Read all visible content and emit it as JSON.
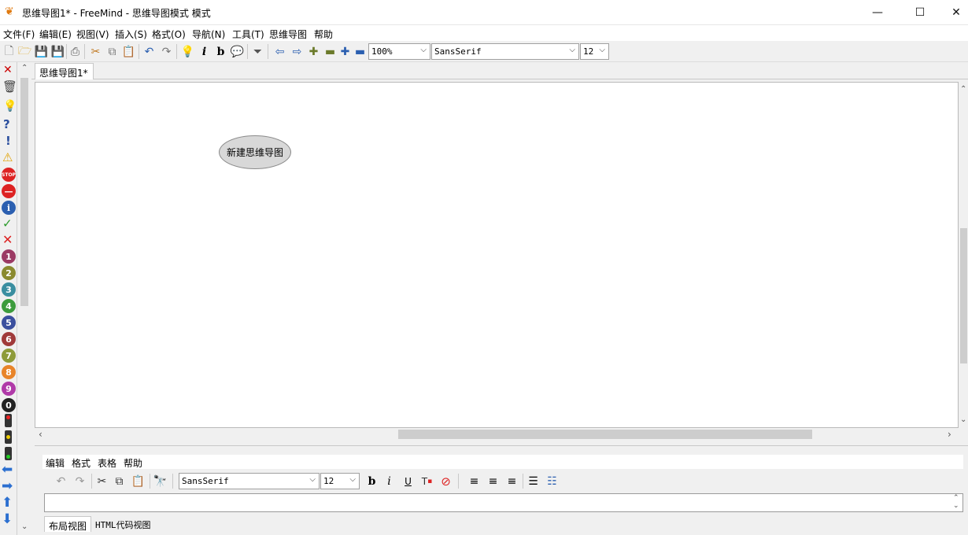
{
  "window": {
    "title": "思维导图1* - FreeMind - 思维导图模式 模式",
    "minimize": "—",
    "maximize": "☐",
    "close": "✕"
  },
  "menu": [
    "文件(F)",
    "编辑(E)",
    "视图(V)",
    "插入(S)",
    "格式(O)",
    "导航(N)",
    "工具(T)",
    "思维导图",
    "帮助"
  ],
  "toolbar": {
    "zoom": "100%",
    "font": "SansSerif",
    "size": "12"
  },
  "tab": {
    "label": "思维导图1*"
  },
  "map": {
    "root_node": "新建思维导图"
  },
  "notes": {
    "menu": [
      "编辑",
      "格式",
      "表格",
      "帮助"
    ],
    "font": "SansSerif",
    "size": "12",
    "bottom_tabs": [
      "布局视图",
      "HTML代码视图"
    ]
  },
  "icons": {
    "icon_numbers": [
      "1",
      "2",
      "3",
      "4",
      "5",
      "6",
      "7",
      "8",
      "9",
      "0"
    ],
    "colors": {
      "number_1": "#9b3a64",
      "number_2": "#8a8a2f",
      "number_3": "#3a8ea0",
      "number_4": "#3c9b3c",
      "number_5": "#3b4f9e",
      "number_6": "#a03a3a",
      "number_7": "#8e9b3a",
      "number_8": "#e8842a",
      "number_9": "#b03aa8",
      "number_0": "#222222"
    }
  }
}
